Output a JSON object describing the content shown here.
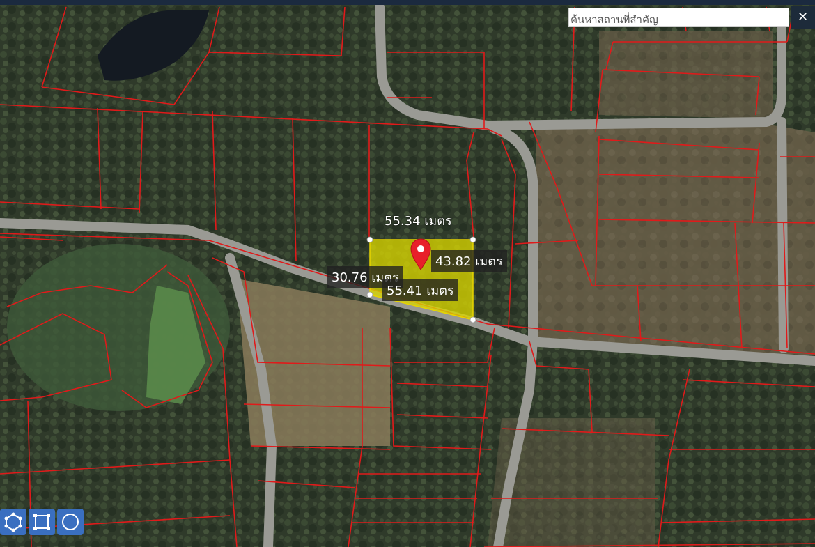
{
  "search": {
    "placeholder": "ค้นหาสถานที่สำคัญ"
  },
  "close_label": "✕",
  "measurements": {
    "top_edge": "55.34 เมตร",
    "right_edge": "43.82 เมตร",
    "left_edge": "30.76 เมตร",
    "bottom_edge": "55.41 เมตร"
  },
  "colors": {
    "parcel_fill": "#d8d600",
    "boundary_lines": "#e01a1a",
    "pin": "#e8202a",
    "tool_buttons": "#3a6fc0"
  },
  "tools": [
    {
      "name": "polygon-tool",
      "icon": "polygon-icon"
    },
    {
      "name": "rectangle-tool",
      "icon": "rectangle-icon"
    },
    {
      "name": "circle-tool",
      "icon": "circle-icon"
    }
  ]
}
